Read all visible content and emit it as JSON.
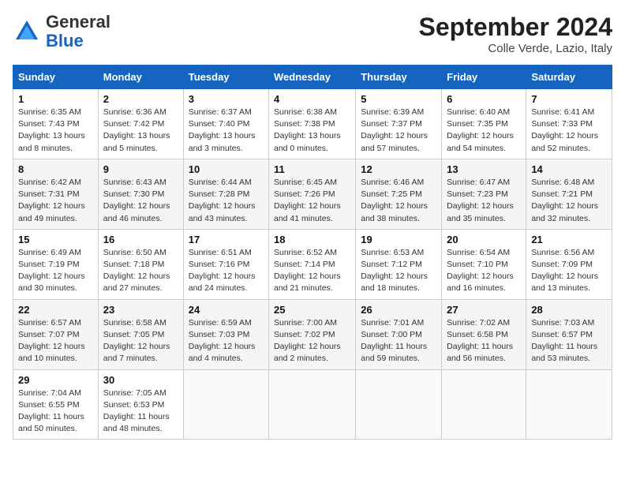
{
  "header": {
    "logo_line1": "General",
    "logo_line2": "Blue",
    "month_year": "September 2024",
    "location": "Colle Verde, Lazio, Italy"
  },
  "weekdays": [
    "Sunday",
    "Monday",
    "Tuesday",
    "Wednesday",
    "Thursday",
    "Friday",
    "Saturday"
  ],
  "weeks": [
    [
      {
        "day": "1",
        "sunrise": "6:35 AM",
        "sunset": "7:43 PM",
        "daylight": "13 hours and 8 minutes."
      },
      {
        "day": "2",
        "sunrise": "6:36 AM",
        "sunset": "7:42 PM",
        "daylight": "13 hours and 5 minutes."
      },
      {
        "day": "3",
        "sunrise": "6:37 AM",
        "sunset": "7:40 PM",
        "daylight": "13 hours and 3 minutes."
      },
      {
        "day": "4",
        "sunrise": "6:38 AM",
        "sunset": "7:38 PM",
        "daylight": "13 hours and 0 minutes."
      },
      {
        "day": "5",
        "sunrise": "6:39 AM",
        "sunset": "7:37 PM",
        "daylight": "12 hours and 57 minutes."
      },
      {
        "day": "6",
        "sunrise": "6:40 AM",
        "sunset": "7:35 PM",
        "daylight": "12 hours and 54 minutes."
      },
      {
        "day": "7",
        "sunrise": "6:41 AM",
        "sunset": "7:33 PM",
        "daylight": "12 hours and 52 minutes."
      }
    ],
    [
      {
        "day": "8",
        "sunrise": "6:42 AM",
        "sunset": "7:31 PM",
        "daylight": "12 hours and 49 minutes."
      },
      {
        "day": "9",
        "sunrise": "6:43 AM",
        "sunset": "7:30 PM",
        "daylight": "12 hours and 46 minutes."
      },
      {
        "day": "10",
        "sunrise": "6:44 AM",
        "sunset": "7:28 PM",
        "daylight": "12 hours and 43 minutes."
      },
      {
        "day": "11",
        "sunrise": "6:45 AM",
        "sunset": "7:26 PM",
        "daylight": "12 hours and 41 minutes."
      },
      {
        "day": "12",
        "sunrise": "6:46 AM",
        "sunset": "7:25 PM",
        "daylight": "12 hours and 38 minutes."
      },
      {
        "day": "13",
        "sunrise": "6:47 AM",
        "sunset": "7:23 PM",
        "daylight": "12 hours and 35 minutes."
      },
      {
        "day": "14",
        "sunrise": "6:48 AM",
        "sunset": "7:21 PM",
        "daylight": "12 hours and 32 minutes."
      }
    ],
    [
      {
        "day": "15",
        "sunrise": "6:49 AM",
        "sunset": "7:19 PM",
        "daylight": "12 hours and 30 minutes."
      },
      {
        "day": "16",
        "sunrise": "6:50 AM",
        "sunset": "7:18 PM",
        "daylight": "12 hours and 27 minutes."
      },
      {
        "day": "17",
        "sunrise": "6:51 AM",
        "sunset": "7:16 PM",
        "daylight": "12 hours and 24 minutes."
      },
      {
        "day": "18",
        "sunrise": "6:52 AM",
        "sunset": "7:14 PM",
        "daylight": "12 hours and 21 minutes."
      },
      {
        "day": "19",
        "sunrise": "6:53 AM",
        "sunset": "7:12 PM",
        "daylight": "12 hours and 18 minutes."
      },
      {
        "day": "20",
        "sunrise": "6:54 AM",
        "sunset": "7:10 PM",
        "daylight": "12 hours and 16 minutes."
      },
      {
        "day": "21",
        "sunrise": "6:56 AM",
        "sunset": "7:09 PM",
        "daylight": "12 hours and 13 minutes."
      }
    ],
    [
      {
        "day": "22",
        "sunrise": "6:57 AM",
        "sunset": "7:07 PM",
        "daylight": "12 hours and 10 minutes."
      },
      {
        "day": "23",
        "sunrise": "6:58 AM",
        "sunset": "7:05 PM",
        "daylight": "12 hours and 7 minutes."
      },
      {
        "day": "24",
        "sunrise": "6:59 AM",
        "sunset": "7:03 PM",
        "daylight": "12 hours and 4 minutes."
      },
      {
        "day": "25",
        "sunrise": "7:00 AM",
        "sunset": "7:02 PM",
        "daylight": "12 hours and 2 minutes."
      },
      {
        "day": "26",
        "sunrise": "7:01 AM",
        "sunset": "7:00 PM",
        "daylight": "11 hours and 59 minutes."
      },
      {
        "day": "27",
        "sunrise": "7:02 AM",
        "sunset": "6:58 PM",
        "daylight": "11 hours and 56 minutes."
      },
      {
        "day": "28",
        "sunrise": "7:03 AM",
        "sunset": "6:57 PM",
        "daylight": "11 hours and 53 minutes."
      }
    ],
    [
      {
        "day": "29",
        "sunrise": "7:04 AM",
        "sunset": "6:55 PM",
        "daylight": "11 hours and 50 minutes."
      },
      {
        "day": "30",
        "sunrise": "7:05 AM",
        "sunset": "6:53 PM",
        "daylight": "11 hours and 48 minutes."
      },
      null,
      null,
      null,
      null,
      null
    ]
  ]
}
